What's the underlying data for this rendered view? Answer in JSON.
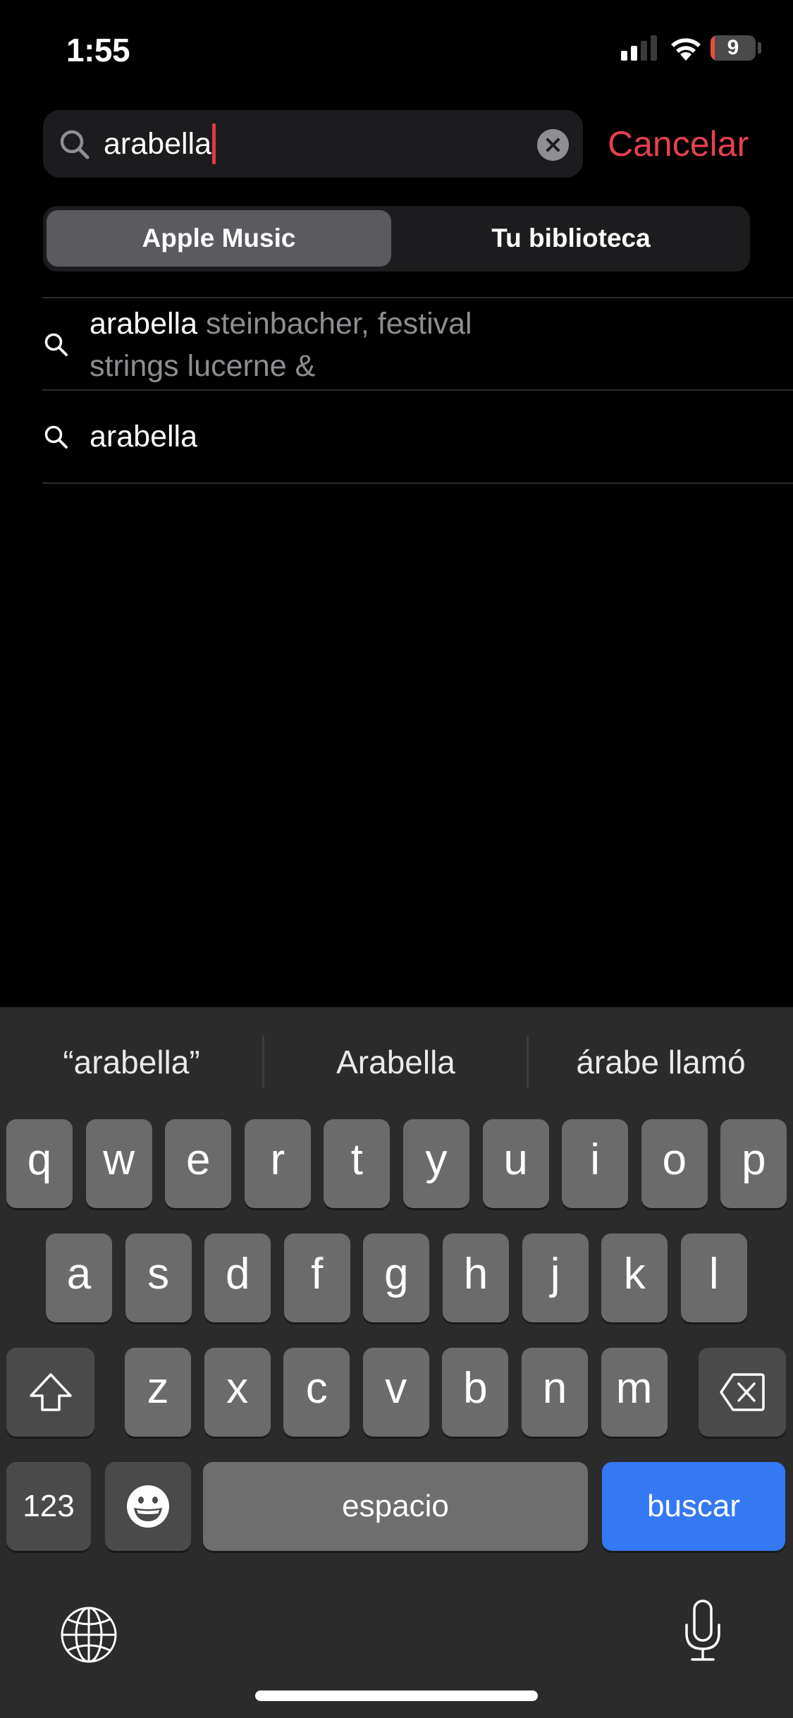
{
  "status_bar": {
    "time": "1:55",
    "signal_bars_active": 2,
    "signal_bars_total": 4,
    "wifi": "wifi-icon",
    "battery_percent": 9,
    "battery_label": "9",
    "battery_color": "#eb4d3d"
  },
  "search": {
    "value": "arabella",
    "clear_icon": "clear-circle-icon",
    "cancel_label": "Cancelar",
    "accent_color": "#e5414f"
  },
  "scope": {
    "tabs": [
      {
        "label": "Apple Music",
        "selected": true
      },
      {
        "label": "Tu biblioteca",
        "selected": false
      }
    ]
  },
  "suggestions": [
    {
      "match": "arabella",
      "rest_line1": " steinbacher, festival",
      "rest_line2": "strings lucerne &"
    },
    {
      "match": "arabella",
      "rest_line1": "",
      "rest_line2": ""
    }
  ],
  "keyboard": {
    "predictions": [
      "“arabella”",
      "Arabella",
      "árabe llamó"
    ],
    "row1": [
      "q",
      "w",
      "e",
      "r",
      "t",
      "y",
      "u",
      "i",
      "o",
      "p"
    ],
    "row2": [
      "a",
      "s",
      "d",
      "f",
      "g",
      "h",
      "j",
      "k",
      "l"
    ],
    "row3": [
      "z",
      "x",
      "c",
      "v",
      "b",
      "n",
      "m"
    ],
    "numbers_label": "123",
    "space_label": "espacio",
    "return_label": "buscar",
    "return_color": "#3578f4"
  }
}
